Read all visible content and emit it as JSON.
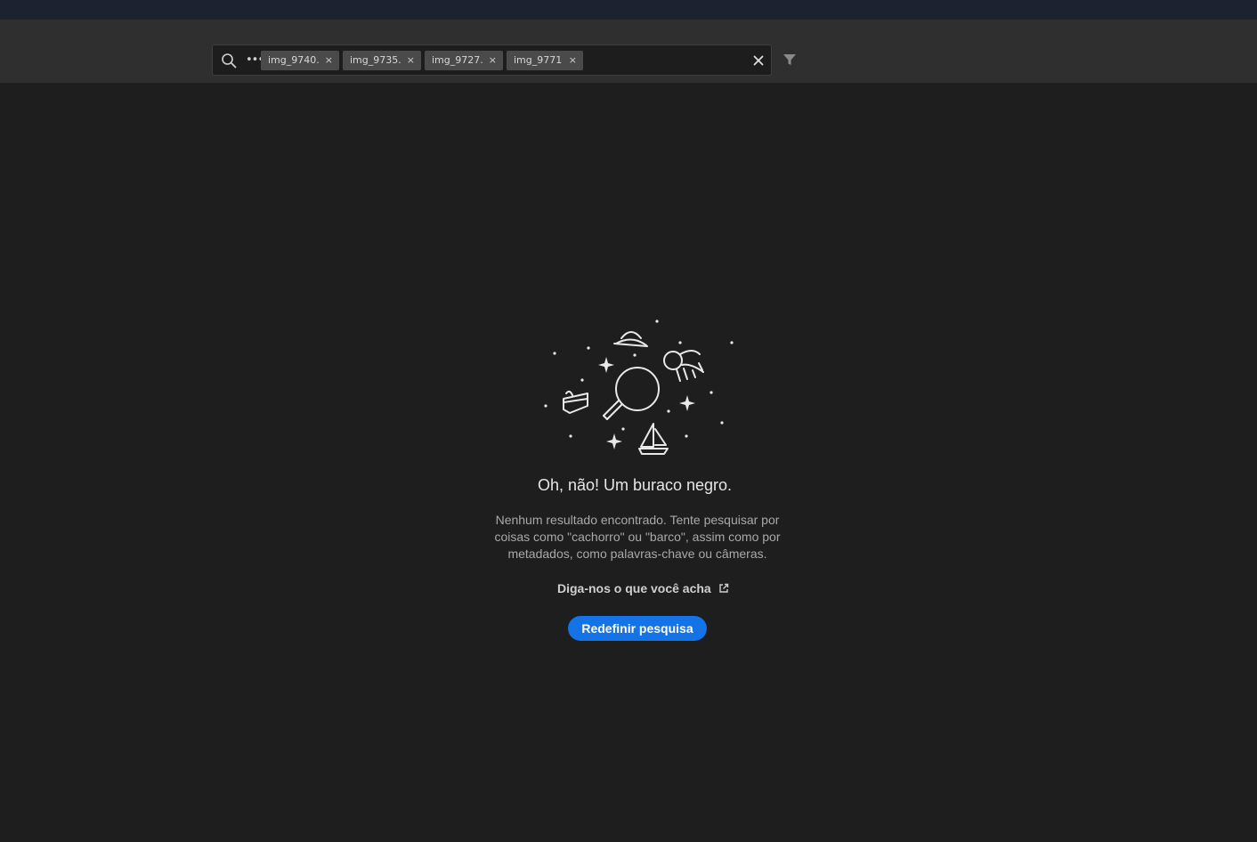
{
  "search": {
    "more_label": "•••",
    "tags": [
      {
        "label": "img_9740.",
        "remove": "×"
      },
      {
        "label": "img_9735.",
        "remove": "×"
      },
      {
        "label": "img_9727.",
        "remove": "×"
      },
      {
        "label": "img_9771",
        "remove": "×"
      }
    ],
    "icons": {
      "search": "search-icon",
      "clear": "close-icon",
      "filter": "filter-icon"
    }
  },
  "empty_state": {
    "illustration": "black-hole-search-illustration",
    "title": "Oh, não! Um buraco negro.",
    "description": "Nenhum resultado encontrado. Tente pesquisar por coisas como \"cachorro\" ou \"barco\", assim como por metadados, como palavras-chave ou câmeras.",
    "feedback_link": "Diga-nos o que você acha",
    "reset_button": "Redefinir pesquisa"
  },
  "colors": {
    "accent": "#1473e6",
    "background": "#1e1e1e",
    "toolbar": "#2f2f2f"
  }
}
